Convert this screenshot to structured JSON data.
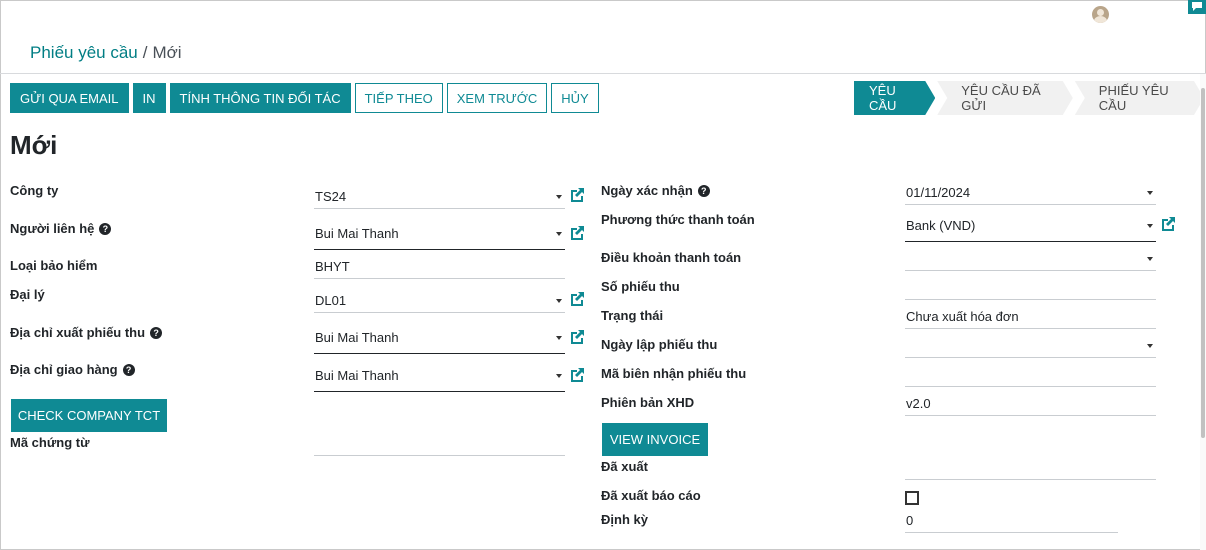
{
  "breadcrumb": {
    "parent": "Phiếu yêu cầu",
    "separator": "/",
    "current": "Mới"
  },
  "toolbar": {
    "buttons": [
      {
        "label": "GỬI QUA EMAIL",
        "style": "primary"
      },
      {
        "label": "IN",
        "style": "primary"
      },
      {
        "label": "TÍNH THÔNG TIN ĐỐI TÁC",
        "style": "primary"
      },
      {
        "label": "TIẾP THEO",
        "style": "secondary"
      },
      {
        "label": "XEM TRƯỚC",
        "style": "secondary"
      },
      {
        "label": "HỦY",
        "style": "secondary"
      }
    ]
  },
  "statusbar": {
    "stages": [
      "YÊU CẦU",
      "YÊU CẦU ĐÃ GỬI",
      "PHIẾU YÊU CẦU"
    ],
    "active_index": 0
  },
  "form": {
    "title": "Mới",
    "left": {
      "company": {
        "label": "Công ty",
        "value": "TS24"
      },
      "contact": {
        "label": "Người liên hệ",
        "value": "Bui Mai Thanh"
      },
      "insurance_type": {
        "label": "Loại bảo hiểm",
        "value": "BHYT"
      },
      "agent": {
        "label": "Đại lý",
        "value": "DL01"
      },
      "invoice_address": {
        "label": "Địa chỉ xuất phiếu thu",
        "value": "Bui Mai Thanh"
      },
      "delivery_address": {
        "label": "Địa chỉ giao hàng",
        "value": "Bui Mai Thanh"
      },
      "check_company_button": "CHECK COMPANY TCT",
      "voucher_code": {
        "label": "Mã chứng từ",
        "value": ""
      }
    },
    "right": {
      "confirm_date": {
        "label": "Ngày xác nhận",
        "value": "01/11/2024"
      },
      "payment_method": {
        "label": "Phương thức thanh toán",
        "value": "Bank (VND)"
      },
      "payment_terms": {
        "label": "Điều khoản thanh toán",
        "value": ""
      },
      "receipt_number": {
        "label": "Số phiếu thu",
        "value": ""
      },
      "status": {
        "label": "Trạng thái",
        "value": "Chưa xuất hóa đơn"
      },
      "receipt_date": {
        "label": "Ngày lập phiếu thu",
        "value": ""
      },
      "receipt_code": {
        "label": "Mã biên nhận phiếu thu",
        "value": ""
      },
      "einvoice_version": {
        "label": "Phiên bản XHD",
        "value": "v2.0"
      },
      "view_invoice_button": "VIEW INVOICE",
      "exported": {
        "label": "Đã xuất",
        "value": ""
      },
      "report_exported": {
        "label": "Đã xuất báo cáo",
        "checked": false
      },
      "periodic": {
        "label": "Định kỳ",
        "value": "0"
      }
    }
  },
  "icons": {
    "help": "question-circle-icon",
    "external": "external-link-icon",
    "dropdown": "caret-down-icon"
  },
  "colors": {
    "primary": "#0f8a94",
    "link": "#017e84"
  }
}
